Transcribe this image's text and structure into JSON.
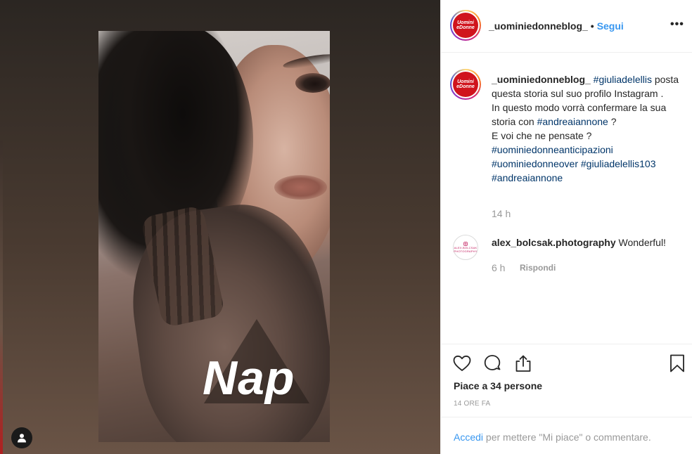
{
  "media": {
    "sticker_text": "Nap"
  },
  "header": {
    "username": "_uominiedonneblog_",
    "dot": "•",
    "follow_label": "Segui",
    "more_label": "•••",
    "avatar_text_line1": "Uomini",
    "avatar_text_line2": "eDonne"
  },
  "caption": {
    "username": "_uominiedonneblog_",
    "tag_1": "#giuliadelellis",
    "text_1": " posta questa storia sul suo profilo Instagram .",
    "text_2": "In questo modo vorrà confermare la sua storia con ",
    "tag_2": "#andreaiannone",
    "text_3": " ?",
    "text_4": "E voi che ne pensate ?",
    "tag_3": "#uominiedonneanticipazioni",
    "tag_4": "#uominiedonneover",
    "tag_5": "#giuliadelellis103",
    "tag_6": "#andreaiannone",
    "time": "14 h"
  },
  "comment": {
    "username": "alex_bolcsak.photography",
    "text": " Wonderful!",
    "time": "6 h",
    "reply_label": "Rispondi",
    "avatar_line1": "ALEX.BOLCSAK",
    "avatar_line2": "PHOTOGRAPHY"
  },
  "actions": {
    "likes": "Piace a 34 persone",
    "timestamp": "14 ORE FA"
  },
  "login": {
    "link": "Accedi",
    "text": " per mettere \"Mi piace\" o commentare."
  },
  "icons": {
    "like": "heart-icon",
    "comment": "comment-icon",
    "share": "share-icon",
    "save": "bookmark-icon",
    "user_tag": "user-icon"
  },
  "colors": {
    "link_blue": "#3897f0",
    "hashtag": "#003569",
    "brand_red": "#d0141d",
    "muted": "#999999"
  }
}
